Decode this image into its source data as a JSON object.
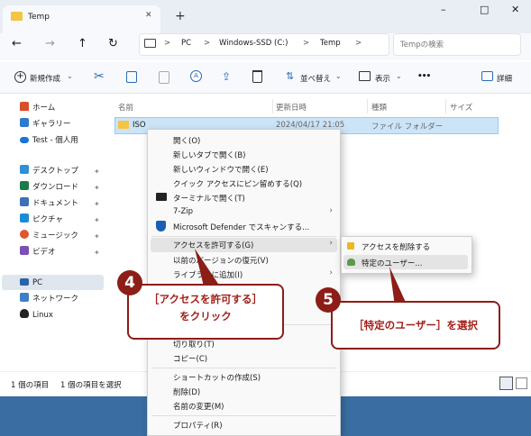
{
  "tab": {
    "title": "Temp",
    "new_tab": "+"
  },
  "window_controls": {
    "minimize": "–",
    "maximize": "□",
    "close": "✕"
  },
  "nav": {
    "back": "←",
    "forward": "→",
    "up": "↑",
    "refresh": "↻"
  },
  "address": {
    "pc": "PC",
    "drive": "Windows-SSD (C:)",
    "folder": "Temp",
    "sep": ">"
  },
  "search": {
    "placeholder": "Tempの検索"
  },
  "toolbar": {
    "new_label": "新規作成",
    "sort_label": "並べ替え",
    "view_label": "表示",
    "more": "•••",
    "details_label": "詳細"
  },
  "sidebar": {
    "home": "ホーム",
    "gallery": "ギャラリー",
    "onedrive": "Test - 個人用",
    "quick": [
      {
        "label": "デスクトップ",
        "color": "#2f8fd8"
      },
      {
        "label": "ダウンロード",
        "color": "#1e7a46"
      },
      {
        "label": "ドキュメント",
        "color": "#3f6fb5"
      },
      {
        "label": "ピクチャ",
        "color": "#1b8bd6"
      },
      {
        "label": "ミュージック",
        "color": "#e0562b"
      },
      {
        "label": "ビデオ",
        "color": "#7b4fb6"
      }
    ],
    "pc": "PC",
    "network": "ネットワーク",
    "linux": "Linux"
  },
  "columns": {
    "name": "名前",
    "date": "更新日時",
    "type": "種類",
    "size": "サイズ"
  },
  "file": {
    "name": "ISO",
    "date": "2024/04/17 21:05",
    "type": "ファイル フォルダー"
  },
  "status": {
    "count": "1 個の項目",
    "selected": "1 個の項目を選択"
  },
  "menu": {
    "open": "開く(O)",
    "open_new_tab": "新しいタブで開く(B)",
    "open_new_window": "新しいウィンドウで開く(E)",
    "pin_quick": "クイック アクセスにピン留めする(Q)",
    "terminal": "ターミナルで開く(T)",
    "zip": "7-Zip",
    "defender": "Microsoft Defender でスキャンする...",
    "give_access": "アクセスを許可する(G)",
    "restore": "以前のバージョンの復元(V)",
    "library": "ライブラリに追加(I)",
    "cut": "切り取り(T)",
    "copy": "コピー(C)",
    "shortcut": "ショートカットの作成(S)",
    "delete": "削除(D)",
    "rename": "名前の変更(M)",
    "properties": "プロパティ(R)"
  },
  "submenu": {
    "remove": "アクセスを削除する",
    "specific": "特定のユーザー..."
  },
  "callout4": {
    "num": "4",
    "line1": "［アクセスを許可する］",
    "line2": "をクリック"
  },
  "callout5": {
    "num": "5",
    "text": "［特定のユーザー］を選択"
  }
}
